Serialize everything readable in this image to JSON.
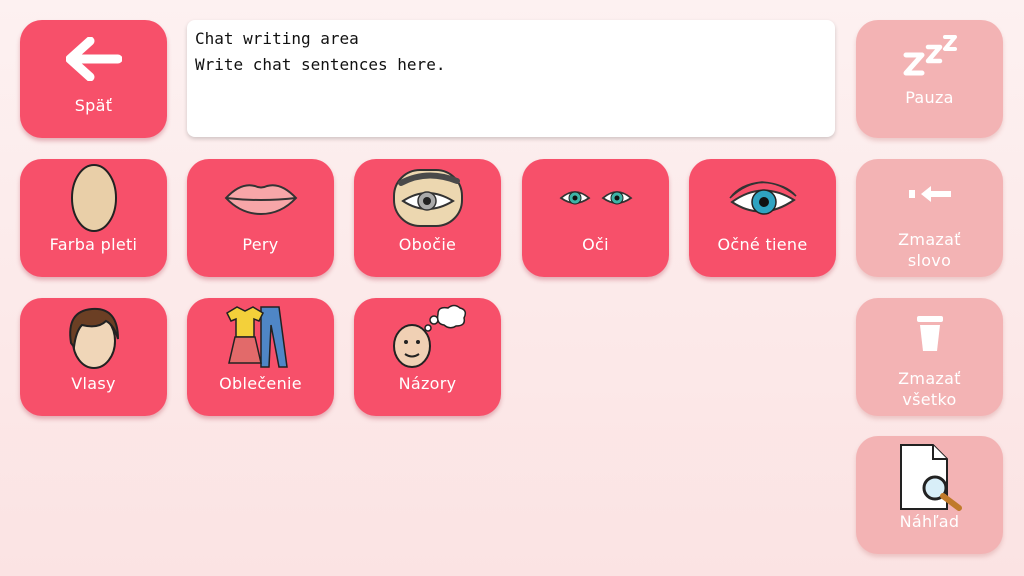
{
  "chat": {
    "title": "Chat writing area",
    "placeholder": "Write chat sentences here."
  },
  "buttons": {
    "back": "Späť",
    "pause": "Pauza",
    "delete_word": [
      "Zmazať",
      "slovo"
    ],
    "delete_all": [
      "Zmazať",
      "všetko"
    ],
    "preview": "Náhľad"
  },
  "categories": [
    {
      "label": "Farba pleti",
      "icon": "face-skin-icon"
    },
    {
      "label": "Pery",
      "icon": "lips-icon"
    },
    {
      "label": "Obočie",
      "icon": "eyebrow-icon"
    },
    {
      "label": "Oči",
      "icon": "eyes-icon"
    },
    {
      "label": "Očné tiene",
      "icon": "eyeshadow-icon"
    },
    {
      "label": "Vlasy",
      "icon": "hair-icon"
    },
    {
      "label": "Oblečenie",
      "icon": "clothes-icon"
    },
    {
      "label": "Názory",
      "icon": "thinking-head-icon"
    }
  ],
  "colors": {
    "tile": "#f7506a",
    "side_tile": "#f3b3b4",
    "background": "#fdf1f1"
  }
}
